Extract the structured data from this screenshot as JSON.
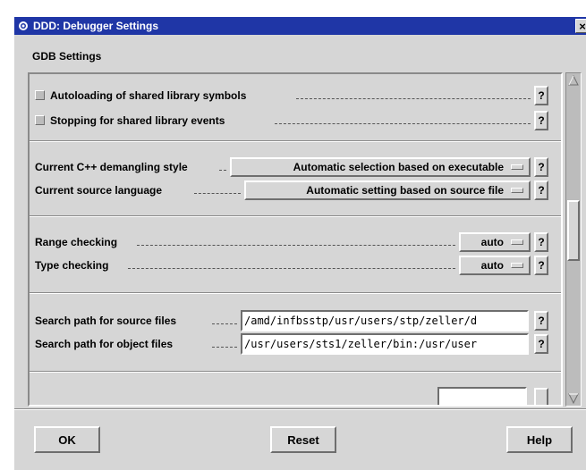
{
  "window": {
    "title": "DDD: Debugger Settings",
    "close_glyph": "×",
    "icon": "ddd-app-icon"
  },
  "section_title": "GDB Settings",
  "help_label": "?",
  "checkboxes": [
    {
      "label": "Autoloading of shared library symbols",
      "checked": false
    },
    {
      "label": "Stopping for shared library events",
      "checked": false
    }
  ],
  "menus": [
    {
      "label": "Current C++ demangling style",
      "value": "Automatic selection based on executable"
    },
    {
      "label": "Current source language",
      "value": "Automatic setting based on source file"
    },
    {
      "label": "Range checking",
      "value": "auto"
    },
    {
      "label": "Type checking",
      "value": "auto"
    }
  ],
  "paths": [
    {
      "label": "Search path for source files",
      "value": "/amd/infbsstp/usr/users/stp/zeller/d"
    },
    {
      "label": "Search path for object files",
      "value": "/usr/users/sts1/zeller/bin:/usr/user"
    }
  ],
  "buttons": {
    "ok": "OK",
    "reset": "Reset",
    "help": "Help"
  },
  "colors": {
    "titlebar": "#1f36a6",
    "background": "#d6d6d6"
  }
}
